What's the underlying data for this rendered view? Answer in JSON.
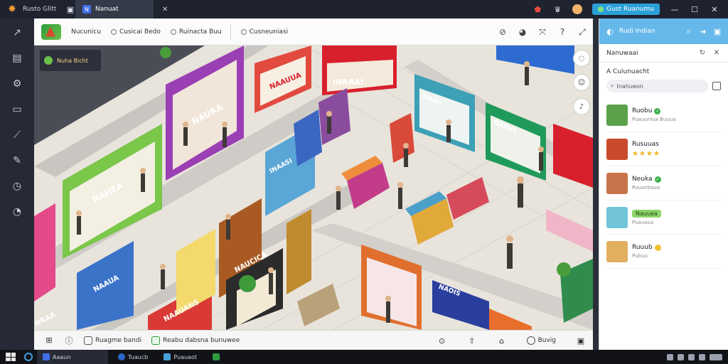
{
  "titlebar": {
    "app_name": "Rusto Glitt",
    "active_tab": "Nanuat",
    "cta_label": "Gust Ruanumu"
  },
  "game": {
    "top": {
      "items": [
        "Nucunicu",
        "Cusicai Bedo",
        "Ruinacta Buu",
        "Cusneuniasi"
      ]
    },
    "hud_label": "Nuha Bicht",
    "bottom": {
      "items": [
        "Ruagme bandi",
        "Reabu dabsna bunuwee",
        "Buvig"
      ]
    },
    "store_signs": [
      "NAHEA",
      "NAURA",
      "INRAAI",
      "NAAUUA",
      "NRAA",
      "NAAUA",
      "NAUCICA",
      "NAAUANS",
      "NAAH",
      "NAAUS",
      "NAOIS",
      "INAASI"
    ]
  },
  "panel": {
    "header_title": "Rudi Indian",
    "subtitle": "Nanuwaai",
    "section_title": "A Cuiunuacht",
    "search_placeholder": "Inahueon",
    "items": [
      {
        "name": "Ruobu",
        "meta": "Puauuniua Buuua",
        "badge": "check",
        "color": "#5aa14a"
      },
      {
        "name": "Rusuuas",
        "meta": "",
        "badge": "stars",
        "stars": "★★★★",
        "color": "#c94a2b"
      },
      {
        "name": "Neuka",
        "meta": "Puuanbaua",
        "badge": "check",
        "color": "#c8744b"
      },
      {
        "name": "Nauuea",
        "meta": "Puauaua",
        "badge": "pill",
        "color": "#72c5d9"
      },
      {
        "name": "Ruuub",
        "meta": "Pubuu",
        "badge": "coin",
        "color": "#e0b060"
      }
    ]
  },
  "taskbar": {
    "apps": [
      "Aaaun",
      "Tuaucb",
      "Puauaot"
    ]
  }
}
